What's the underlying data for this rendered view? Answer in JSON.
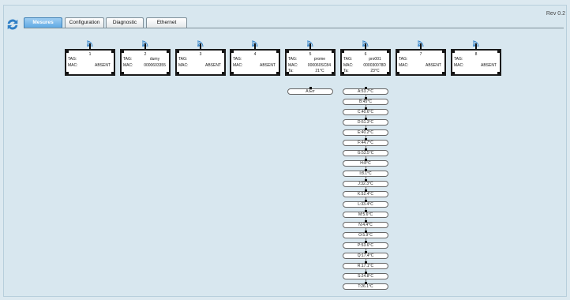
{
  "header": {
    "revision": "Rev 0.2"
  },
  "tabs": [
    {
      "label": "Mesures"
    },
    {
      "label": "Configuration"
    },
    {
      "label": "Diagnostic"
    },
    {
      "label": "Ethernet"
    }
  ],
  "labels": {
    "tag": "TAG:",
    "mac": "MAC:",
    "ta": "Ta:"
  },
  "nodes": [
    {
      "num": "1",
      "tag": "",
      "mac": "ABSENT"
    },
    {
      "num": "2",
      "tag": "dumy",
      "mac": "0000603355"
    },
    {
      "num": "3",
      "tag": "",
      "mac": "ABSENT"
    },
    {
      "num": "4",
      "tag": "",
      "mac": "ABSENT"
    },
    {
      "num": "5",
      "tag": "prome",
      "mac": "000060SC84",
      "ta": "21°C"
    },
    {
      "num": "6",
      "tag": "pro001",
      "mac": "000030078D",
      "ta": "23°C"
    },
    {
      "num": "7",
      "tag": "",
      "mac": "ABSENT"
    },
    {
      "num": "8",
      "tag": "",
      "mac": "ABSENT"
    }
  ],
  "sensors_node5": [
    "A:Err"
  ],
  "sensors_node6": [
    "A:53.7°C",
    "B:45°C",
    "C:40.6°C",
    "D:51.3°C",
    "E:40.2°C",
    "F:44.7°C",
    "G:53.5°C",
    "H:8°C",
    "I:8.1°C",
    "J:32.3°C",
    "K:52.4°C",
    "L:33.4°C",
    "M:5.6°C",
    "N:4.4°C",
    "O:5.9°C",
    "P:53.6°C",
    "Q:17.4°C",
    "R:17.1°C",
    "S:24.8°C",
    "T:26.1°C"
  ]
}
